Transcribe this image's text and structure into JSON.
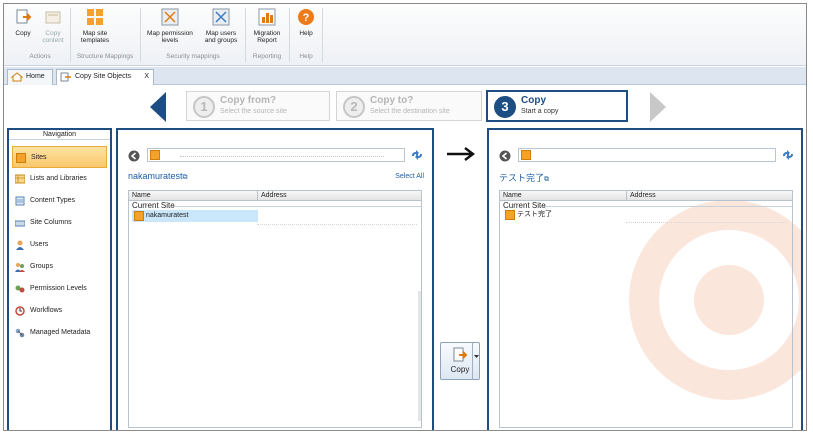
{
  "ribbon": {
    "buttons": [
      {
        "label": "Copy",
        "icon": "copy-icon"
      },
      {
        "label": "Copy content",
        "icon": "copy-content-icon"
      },
      {
        "label": "Map site templates",
        "icon": "map-site-templates-icon"
      },
      {
        "label": "Map permission levels",
        "icon": "map-permission-levels-icon"
      },
      {
        "label": "Map users and groups",
        "icon": "map-users-groups-icon"
      },
      {
        "label": "Migration Report",
        "icon": "migration-report-icon"
      },
      {
        "label": "Help",
        "icon": "help-icon"
      }
    ],
    "groups": [
      "Actions",
      "Structure Mappings",
      "Security mappings",
      "Reporting",
      "Help"
    ]
  },
  "tabs": [
    {
      "label": "Home"
    },
    {
      "label": "Copy Site Objects"
    }
  ],
  "tab_close": "X",
  "wizard": {
    "steps": [
      {
        "num": "1",
        "title": "Copy from?",
        "subtitle": "Select the source site"
      },
      {
        "num": "2",
        "title": "Copy to?",
        "subtitle": "Select the destination site"
      },
      {
        "num": "3",
        "title": "Copy",
        "subtitle": "Start a copy"
      }
    ]
  },
  "navigation": {
    "title": "Navigation",
    "items": [
      {
        "label": "Sites"
      },
      {
        "label": "Lists and Libraries"
      },
      {
        "label": "Content Types"
      },
      {
        "label": "Site Columns"
      },
      {
        "label": "Users"
      },
      {
        "label": "Groups"
      },
      {
        "label": "Permission Levels"
      },
      {
        "label": "Workflows"
      },
      {
        "label": "Managed Metadata"
      }
    ]
  },
  "source": {
    "site_name": "nakamuratest",
    "select_all": "Select All",
    "columns": [
      "Name",
      "Address"
    ],
    "group_label": "Current Site",
    "row": "nakamuratest"
  },
  "destination": {
    "site_name": "テスト完了",
    "columns": [
      "Name",
      "Address"
    ],
    "group_label": "Current Site",
    "row": "テスト完了"
  },
  "copy_button": {
    "label": "Copy"
  },
  "colors": {
    "accent": "#1c4e84",
    "selection": "#f9c86b",
    "link": "#1f5fa8"
  }
}
